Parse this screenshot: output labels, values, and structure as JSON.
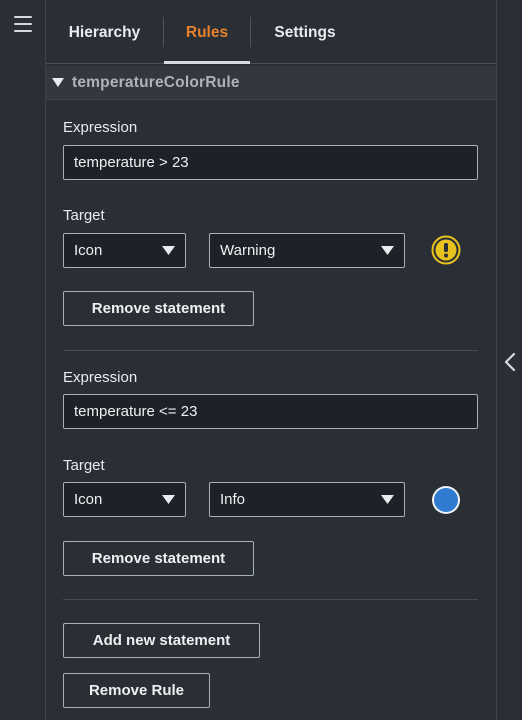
{
  "tabs": [
    {
      "label": "Hierarchy",
      "active": false
    },
    {
      "label": "Rules",
      "active": true
    },
    {
      "label": "Settings",
      "active": false
    }
  ],
  "rule": {
    "name": "temperatureColorRule",
    "statements": [
      {
        "expression_label": "Expression",
        "expression_value": "temperature > 23",
        "target_label": "Target",
        "target_type": "Icon",
        "target_value": "Warning",
        "target_icon": "warning-exclamation-icon",
        "remove_label": "Remove statement"
      },
      {
        "expression_label": "Expression",
        "expression_value": "temperature <= 23",
        "target_label": "Target",
        "target_type": "Icon",
        "target_value": "Info",
        "target_icon": "info-circle-icon",
        "remove_label": "Remove statement"
      }
    ],
    "add_statement_label": "Add new statement",
    "remove_rule_label": "Remove Rule"
  },
  "colors": {
    "accent": "#e8822a",
    "warning": "#e8c21f",
    "info": "#2f7bd0"
  }
}
